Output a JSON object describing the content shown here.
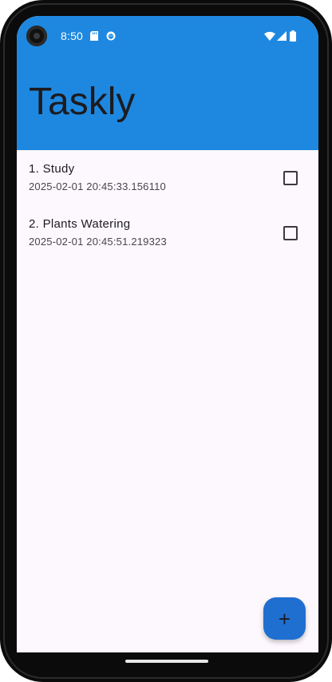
{
  "status_bar": {
    "time": "8:50",
    "icons": [
      "sd-card-icon",
      "face-icon",
      "wifi-icon",
      "signal-icon",
      "battery-icon"
    ]
  },
  "app_bar": {
    "title": "Taskly",
    "color": "#1e88e0"
  },
  "tasks": [
    {
      "title": "1. Study",
      "timestamp": "2025-02-01 20:45:33.156110",
      "checked": false
    },
    {
      "title": "2. Plants Watering",
      "timestamp": "2025-02-01 20:45:51.219323",
      "checked": false
    }
  ],
  "fab": {
    "icon": "plus-icon",
    "label": "+",
    "color": "#1f6fd1"
  }
}
